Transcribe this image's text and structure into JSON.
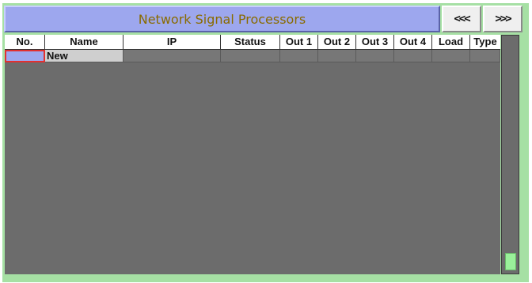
{
  "window": {
    "title": "Network Signal Processors"
  },
  "nav": {
    "prev_label": "<<<",
    "next_label": ">>>"
  },
  "table": {
    "columns": [
      "No.",
      "Name",
      "IP",
      "Status",
      "Out 1",
      "Out 2",
      "Out 3",
      "Out 4",
      "Load",
      "Type"
    ],
    "rows": [
      {
        "no": "",
        "name": "New",
        "ip": "",
        "status": "",
        "out1": "",
        "out2": "",
        "out3": "",
        "out4": "",
        "load": "",
        "type": ""
      }
    ]
  },
  "colors": {
    "frame_bg": "#a6e0a4",
    "title_bar": "#9da7ee",
    "title_text": "#8a6b00",
    "grid_bg": "#6c6c6c",
    "selected_cell_border": "#e23030",
    "scroll_thumb": "#9af09a"
  }
}
